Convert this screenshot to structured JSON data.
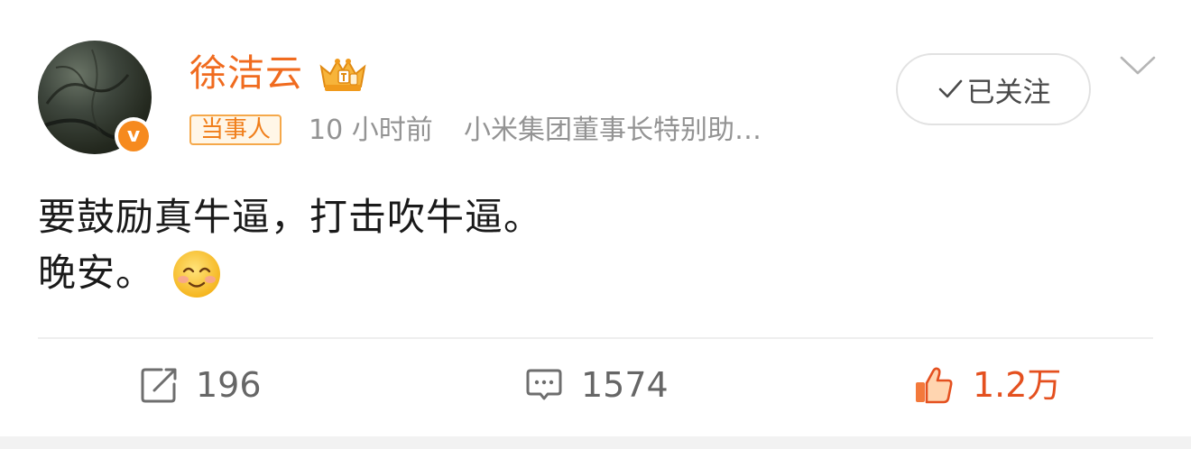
{
  "user": {
    "name": "徐洁云",
    "badge_label": "当事人",
    "time": "10 小时前",
    "description": "小米集团董事长特别助…",
    "verified_mark": "v"
  },
  "follow": {
    "label": "已关注"
  },
  "post": {
    "lines": [
      "要鼓励真牛逼，打击吹牛逼。",
      "晚安。"
    ]
  },
  "actions": {
    "repost_count": "196",
    "comment_count": "1574",
    "like_count": "1.2万"
  },
  "colors": {
    "accent": "#f06b1f",
    "like": "#e4501f",
    "muted": "#939393"
  },
  "icons": [
    "crown-icon",
    "check-icon",
    "chevron-down-icon",
    "smile-emoji-icon",
    "repost-icon",
    "comment-icon",
    "thumbs-up-icon"
  ]
}
